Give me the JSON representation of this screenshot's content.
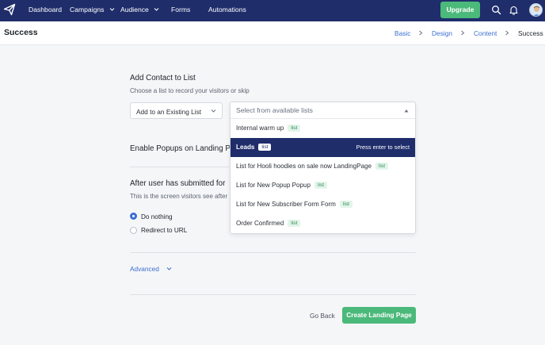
{
  "nav": {
    "items": [
      {
        "label": "Dashboard"
      },
      {
        "label": "Campaigns"
      },
      {
        "label": "Audience"
      },
      {
        "label": "Forms"
      },
      {
        "label": "Automations"
      }
    ],
    "upgrade_label": "Upgrade",
    "icons": {
      "logo": "paper-plane-icon",
      "search": "search-icon",
      "bell": "bell-icon",
      "avatar": "avatar"
    }
  },
  "header": {
    "title": "Success",
    "breadcrumb": [
      "Basic",
      "Design",
      "Content",
      "Success"
    ]
  },
  "main": {
    "add_contact": {
      "title": "Add Contact to List",
      "subtitle": "Choose a list to record your visitors or skip",
      "mode_value": "Add to an Existing List",
      "list_placeholder": "Select from available lists"
    },
    "popups": {
      "title": "Enable Popups on Landing P"
    },
    "after_submit": {
      "title": "After user has submitted for",
      "subtitle": "This is the screen visitors see after",
      "options": [
        {
          "label": "Do nothing",
          "checked": true
        },
        {
          "label": "Redirect to URL",
          "checked": false
        }
      ]
    },
    "advanced_label": "Advanced",
    "go_back_label": "Go Back",
    "create_label": "Create Landing Page"
  },
  "dropdown": {
    "items": [
      {
        "label": "Internal warm up",
        "badge": "list"
      },
      {
        "label": "Leads",
        "badge": "list",
        "hint": "Press enter to select"
      },
      {
        "label": "List for Hooli hoodies on sale now LandingPage",
        "badge": "list"
      },
      {
        "label": "List for New Popup Popup",
        "badge": "list"
      },
      {
        "label": "List for New Subscriber Form Form",
        "badge": "list"
      },
      {
        "label": "Order Confirmed",
        "badge": "list"
      }
    ]
  },
  "colors": {
    "nav_bg": "#1f2d6b",
    "accent_green": "#4bb97a",
    "link_blue": "#3b6fd0",
    "badge_bg": "#e3f5ea",
    "badge_text": "#2e8a55"
  }
}
